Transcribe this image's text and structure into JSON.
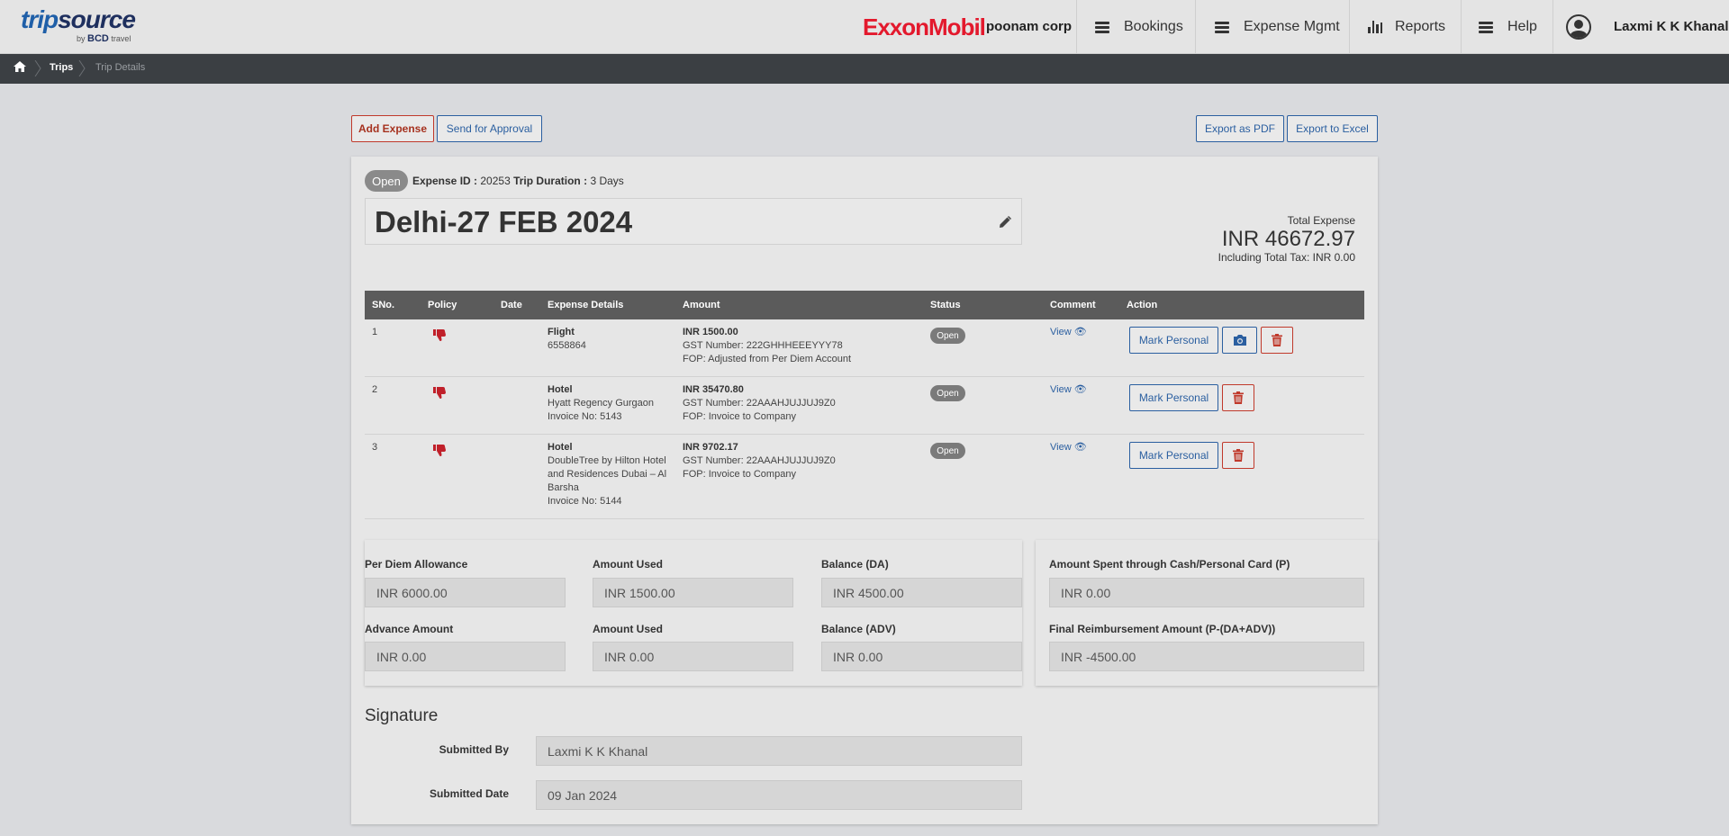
{
  "brand": {
    "logo_part1": "trip",
    "logo_part2": "source",
    "logo_by": "by",
    "logo_bcd": "BCD",
    "logo_travel": "travel"
  },
  "header": {
    "client_logo": "ExxonMobil",
    "corp_name": "poonam corp",
    "nav": [
      {
        "label": "Bookings",
        "icon": "hamburger-icon"
      },
      {
        "label": "Expense Mgmt",
        "icon": "hamburger-icon"
      },
      {
        "label": "Reports",
        "icon": "bar-chart-icon"
      },
      {
        "label": "Help",
        "icon": "hamburger-icon"
      }
    ],
    "user_name": "Laxmi K K Khanal"
  },
  "breadcrumb": {
    "items": [
      "Trips",
      "Trip Details"
    ]
  },
  "toolbar": {
    "add_expense": "Add Expense",
    "send_approval": "Send for Approval",
    "export_pdf": "Export as PDF",
    "export_excel": "Export to Excel"
  },
  "expense": {
    "status": "Open",
    "id_label": "Expense ID :",
    "id_value": "20253",
    "duration_label": "Trip Duration :",
    "duration_value": "3 Days",
    "title": "Delhi-27 FEB 2024",
    "total_label": "Total Expense",
    "total_value": "INR 46672.97",
    "tax_line": "Including Total Tax: INR 0.00"
  },
  "table": {
    "headers": [
      "SNo.",
      "Policy",
      "Date",
      "Expense Details",
      "Amount",
      "Status",
      "Comment",
      "Action"
    ],
    "rows": [
      {
        "sno": "1",
        "date": "",
        "type": "Flight",
        "detail1": "6558864",
        "detail2": "",
        "detail3": "",
        "amount": "INR 1500.00",
        "gst": "GST Number: 222GHHHEEEYYY78",
        "fop": "FOP: Adjusted from Per Diem Account",
        "status": "Open",
        "comment": "View",
        "action": "Mark Personal"
      },
      {
        "sno": "2",
        "date": "",
        "type": "Hotel",
        "detail1": "Hyatt Regency Gurgaon",
        "detail2": "Invoice No: 5143",
        "detail3": "",
        "amount": "INR 35470.80",
        "gst": "GST Number: 22AAAHJUJJUJ9Z0",
        "fop": "FOP: Invoice to Company",
        "status": "Open",
        "comment": "View",
        "action": "Mark Personal"
      },
      {
        "sno": "3",
        "date": "",
        "type": "Hotel",
        "detail1": "DoubleTree by Hilton Hotel",
        "detail2": "and Residences Dubai – Al",
        "detail3": "Barsha",
        "detail4": "Invoice No: 5144",
        "amount": "INR 9702.17",
        "gst": "GST Number: 22AAAHJUJJUJ9Z0",
        "fop": "FOP: Invoice to Company",
        "status": "Open",
        "comment": "View",
        "action": "Mark Personal"
      }
    ]
  },
  "summary": {
    "per_diem_label": "Per Diem Allowance",
    "per_diem_value": "INR 6000.00",
    "used1_label": "Amount Used",
    "used1_value": "INR 1500.00",
    "bal_da_label": "Balance (DA)",
    "bal_da_value": "INR 4500.00",
    "advance_label": "Advance Amount",
    "advance_value": "INR 0.00",
    "used2_label": "Amount Used",
    "used2_value": "INR 0.00",
    "bal_adv_label": "Balance (ADV)",
    "bal_adv_value": "INR 0.00",
    "spent_label": "Amount Spent through Cash/Personal Card (P)",
    "spent_value": "INR 0.00",
    "final_label": "Final Reimbursement Amount (P-(DA+ADV))",
    "final_value": "INR -4500.00"
  },
  "signature": {
    "heading": "Signature",
    "submitted_by_label": "Submitted By",
    "submitted_by_value": "Laxmi  K K Khanal",
    "submitted_date_label": "Submitted Date",
    "submitted_date_value": "09 Jan 2024"
  }
}
